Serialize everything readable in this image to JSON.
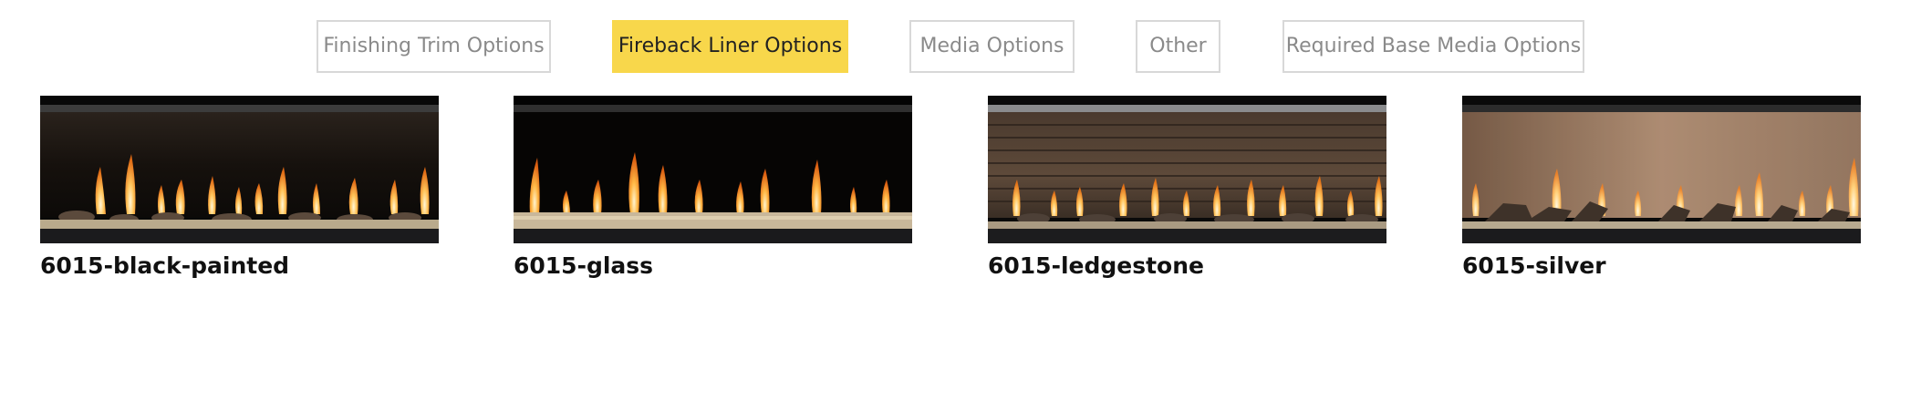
{
  "tabs": [
    {
      "label": "Finishing Trim Options",
      "active": false
    },
    {
      "label": "Fireback Liner Options",
      "active": true
    },
    {
      "label": "Media Options",
      "active": false
    },
    {
      "label": "Other",
      "active": false
    },
    {
      "label": "Required Base Media Options",
      "active": false
    }
  ],
  "colors": {
    "active_tab": "#f8d74b",
    "tab_border": "#d8d8d8",
    "tab_text": "#8a8a8a"
  },
  "liners": [
    {
      "label": "6015-black-painted",
      "image": "fireplace-black-painted-liner"
    },
    {
      "label": "6015-glass",
      "image": "fireplace-glass-liner"
    },
    {
      "label": "6015-ledgestone",
      "image": "fireplace-ledgestone-liner"
    },
    {
      "label": "6015-silver",
      "image": "fireplace-silver-liner"
    }
  ]
}
